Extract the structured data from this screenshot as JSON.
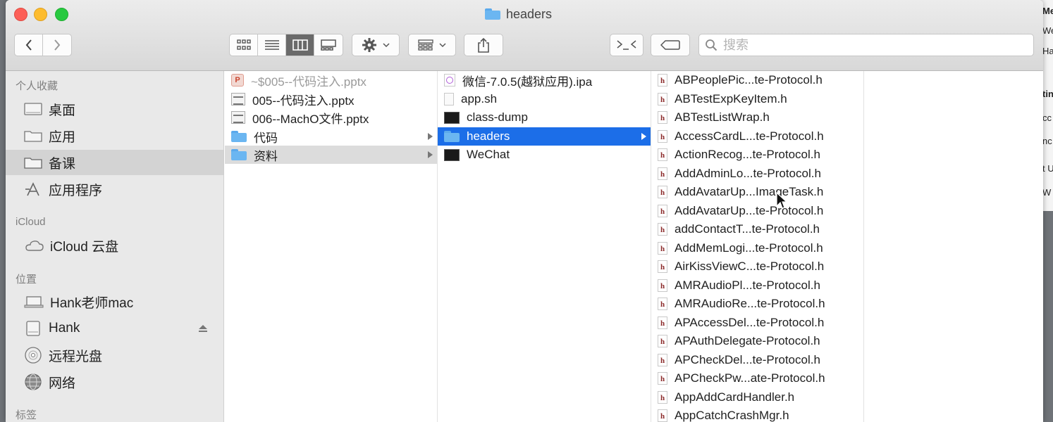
{
  "window": {
    "title": "headers"
  },
  "search": {
    "placeholder": "搜索"
  },
  "sidebar": {
    "sections": [
      {
        "label": "个人收藏"
      },
      {
        "label": "iCloud"
      },
      {
        "label": "位置"
      },
      {
        "label": "标签"
      }
    ],
    "items": [
      {
        "label": "桌面",
        "icon": "desktop-icon"
      },
      {
        "label": "应用",
        "icon": "folder-icon"
      },
      {
        "label": "备课",
        "icon": "folder-icon",
        "selected": true
      },
      {
        "label": "应用程序",
        "icon": "applications-icon"
      },
      {
        "label": "iCloud 云盘",
        "icon": "cloud-icon"
      },
      {
        "label": "Hank老师mac",
        "icon": "laptop-icon"
      },
      {
        "label": "Hank",
        "icon": "disk-icon"
      },
      {
        "label": "远程光盘",
        "icon": "disc-icon"
      },
      {
        "label": "网络",
        "icon": "network-icon"
      }
    ]
  },
  "columns": {
    "col1": [
      {
        "name": "~$005--代码注入.pptx",
        "type": "pptx-temp"
      },
      {
        "name": "005--代码注入.pptx",
        "type": "pptx"
      },
      {
        "name": "006--MachO文件.pptx",
        "type": "pptx"
      },
      {
        "name": "代码",
        "type": "folder"
      },
      {
        "name": "资料",
        "type": "folder",
        "selected": true
      }
    ],
    "col2": [
      {
        "name": "微信-7.0.5(越狱应用).ipa",
        "type": "ipa"
      },
      {
        "name": "app.sh",
        "type": "doc"
      },
      {
        "name": "class-dump",
        "type": "exec"
      },
      {
        "name": "headers",
        "type": "folder",
        "selected": true
      },
      {
        "name": "WeChat",
        "type": "exec"
      }
    ],
    "col3": [
      "ABPeoplePic...te-Protocol.h",
      "ABTestExpKeyItem.h",
      "ABTestListWrap.h",
      "AccessCardL...te-Protocol.h",
      "ActionRecog...te-Protocol.h",
      "AddAdminLo...te-Protocol.h",
      "AddAvatarUp...ImageTask.h",
      "AddAvatarUp...te-Protocol.h",
      "addContactT...te-Protocol.h",
      "AddMemLogi...te-Protocol.h",
      "AirKissViewC...te-Protocol.h",
      "AMRAudioPl...te-Protocol.h",
      "AMRAudioRe...te-Protocol.h",
      "APAccessDel...te-Protocol.h",
      "APAuthDelegate-Protocol.h",
      "APCheckDel...te-Protocol.h",
      "APCheckPw...ate-Protocol.h",
      "AppAddCardHandler.h",
      "AppCatchCrashMgr.h"
    ]
  },
  "background_window": {
    "fragments": [
      "Me",
      "We",
      "Ha",
      "tin",
      "cc",
      "nc",
      "t U",
      "W"
    ]
  }
}
